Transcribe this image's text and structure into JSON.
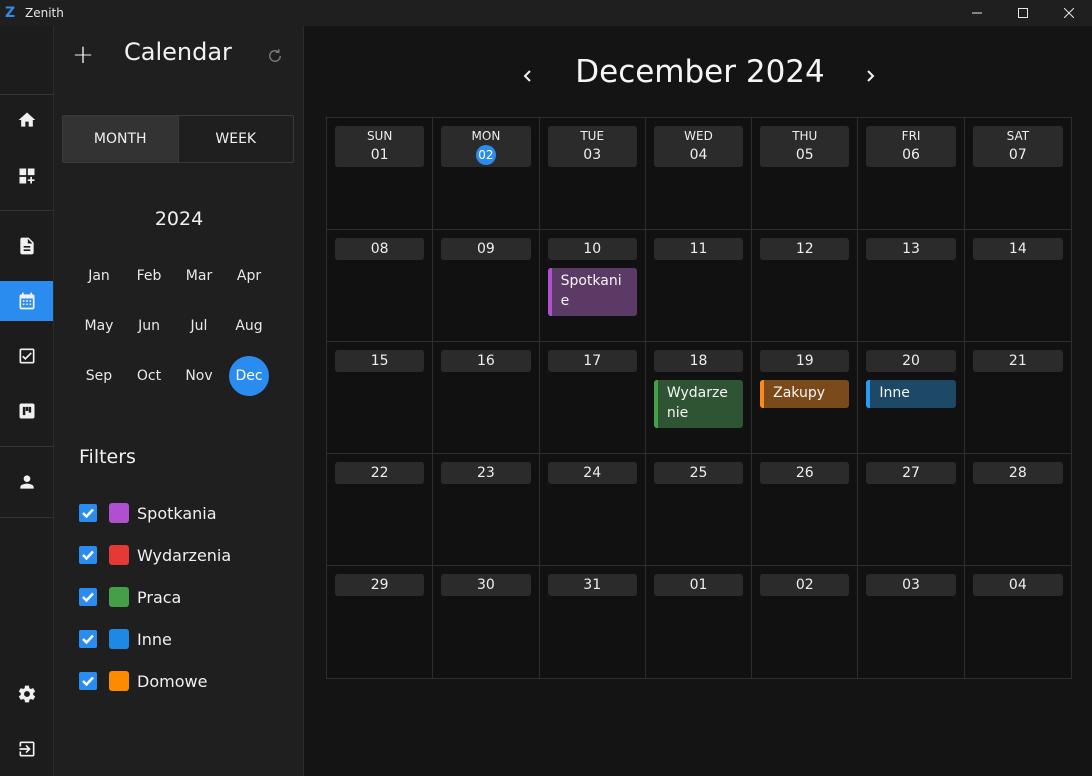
{
  "window": {
    "title": "Zenith",
    "logo_letter": "Z"
  },
  "sidebar": {
    "title": "Calendar",
    "view_tabs": [
      {
        "label": "MONTH",
        "active": true
      },
      {
        "label": "WEEK",
        "active": false
      }
    ],
    "year": "2024",
    "months": [
      "Jan",
      "Feb",
      "Mar",
      "Apr",
      "May",
      "Jun",
      "Jul",
      "Aug",
      "Sep",
      "Oct",
      "Nov",
      "Dec"
    ],
    "selected_month": "Dec",
    "filters_title": "Filters",
    "filters": [
      {
        "label": "Spotkania",
        "color": "#b04fcf",
        "checked": true
      },
      {
        "label": "Wydarzenia",
        "color": "#e53935",
        "checked": true
      },
      {
        "label": "Praca",
        "color": "#43a047",
        "checked": true
      },
      {
        "label": "Inne",
        "color": "#1e88e5",
        "checked": true
      },
      {
        "label": "Domowe",
        "color": "#fb8c00",
        "checked": true
      }
    ]
  },
  "calendar": {
    "title": "December 2024",
    "weekdays": [
      "SUN",
      "MON",
      "TUE",
      "WED",
      "THU",
      "FRI",
      "SAT"
    ],
    "today": "02",
    "weeks": [
      [
        "01",
        "02",
        "03",
        "04",
        "05",
        "06",
        "07"
      ],
      [
        "08",
        "09",
        "10",
        "11",
        "12",
        "13",
        "14"
      ],
      [
        "15",
        "16",
        "17",
        "18",
        "19",
        "20",
        "21"
      ],
      [
        "22",
        "23",
        "24",
        "25",
        "26",
        "27",
        "28"
      ],
      [
        "29",
        "30",
        "31",
        "01",
        "02",
        "03",
        "04"
      ]
    ],
    "events": [
      {
        "week": 1,
        "day": 2,
        "title": "Spotkani e",
        "kind": "meet"
      },
      {
        "week": 2,
        "day": 3,
        "title": "Wydarze nie",
        "kind": "event"
      },
      {
        "week": 2,
        "day": 4,
        "title": "Zakupy",
        "kind": "shop"
      },
      {
        "week": 2,
        "day": 5,
        "title": "Inne",
        "kind": "other"
      }
    ]
  },
  "colors": {
    "accent": "#2b8cf0"
  }
}
